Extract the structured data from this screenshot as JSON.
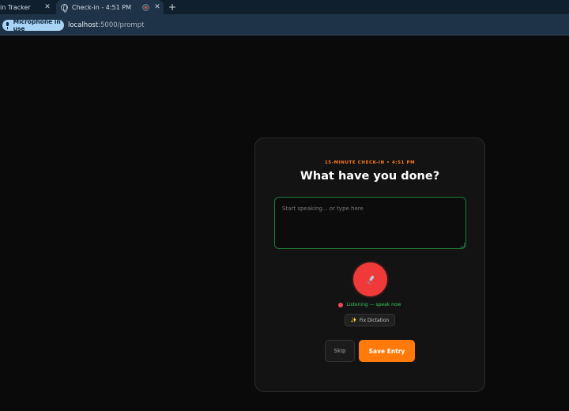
{
  "browser": {
    "tabs": [
      {
        "label": "in Tracker",
        "active": false
      },
      {
        "label": "Check-in - 4:51 PM",
        "active": true
      }
    ],
    "new_tab_label": "+",
    "close_glyph": "✕",
    "mic_chip_label": "Microphone in use",
    "url_host": "localhost",
    "url_path": ":5000/prompt"
  },
  "card": {
    "kicker": "15-MINUTE CHECK-IN • 4:51 PM",
    "heading": "What have you done?",
    "entry_placeholder": "Start speaking... or type here",
    "entry_value": "",
    "mic_button_icon": "microphone-icon",
    "status_text": "Listening — speak now",
    "fix_button_label": "Fix Dictation",
    "skip_label": "Skip",
    "save_label": "Save Entry"
  },
  "colors": {
    "accent": "#ff7a0a",
    "mic_red": "#f03a3a",
    "status_green": "#32c75a",
    "textarea_border": "#1f7a3a",
    "page_bg": "#0a0a0a",
    "card_bg": "#131313"
  }
}
